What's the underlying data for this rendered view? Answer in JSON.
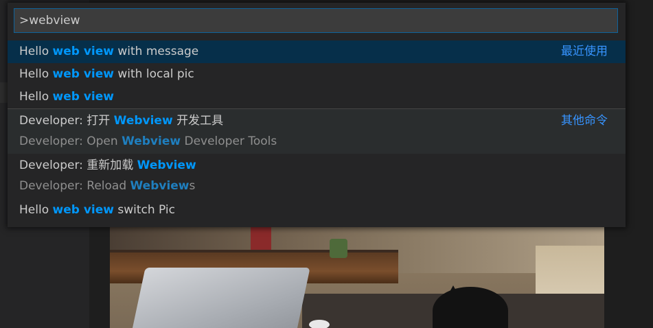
{
  "search": {
    "value": ">webview"
  },
  "items": [
    {
      "prefix": "Hello ",
      "match": "web view",
      "suffix": " with message",
      "group": "最近使用"
    },
    {
      "prefix": "Hello ",
      "match": "web view",
      "suffix": " with local pic"
    },
    {
      "prefix": "Hello ",
      "match": "web view",
      "suffix": ""
    },
    {
      "prefix": "Developer: 打开 ",
      "match": "Webview",
      "suffix": " 开发工具",
      "group": "其他命令",
      "detail": {
        "prefix": "Developer: Open ",
        "match": "Webview",
        "suffix": " Developer Tools"
      }
    },
    {
      "prefix": "Developer: 重新加载 ",
      "match": "Webview",
      "suffix": "",
      "detail": {
        "prefix": "Developer: Reload ",
        "match": "Webview",
        "suffix": "s"
      }
    },
    {
      "prefix": "Hello ",
      "match": "web view",
      "suffix": " switch Pic"
    }
  ],
  "colors": {
    "highlight": "#0097fb",
    "focus_border": "#0e639c",
    "focused_row": "#062f4a",
    "group_label": "#3794ff"
  }
}
